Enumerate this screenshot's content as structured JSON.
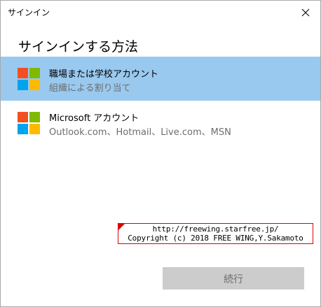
{
  "window": {
    "title": "サインイン"
  },
  "heading": "サインインする方法",
  "options": [
    {
      "title": "職場または学校アカウント",
      "subtitle": "組織による割り当て",
      "selected": true
    },
    {
      "title": "Microsoft アカウント",
      "subtitle": "Outlook.com、Hotmail、Live.com、MSN",
      "selected": false
    }
  ],
  "watermark": {
    "line1": "http://freewing.starfree.jp/",
    "line2": "Copyright (c) 2018 FREE WING,Y.Sakamoto"
  },
  "buttons": {
    "continue_label": "続行"
  },
  "colors": {
    "selection": "#99c9ef",
    "ms_red": "#f25022",
    "ms_green": "#7fba00",
    "ms_blue": "#00a4ef",
    "ms_yellow": "#ffb900",
    "disabled_button": "#cccccc",
    "watermark_border": "#e00000"
  },
  "icons": {
    "close": "close-icon",
    "logo": "microsoft-logo-icon"
  }
}
